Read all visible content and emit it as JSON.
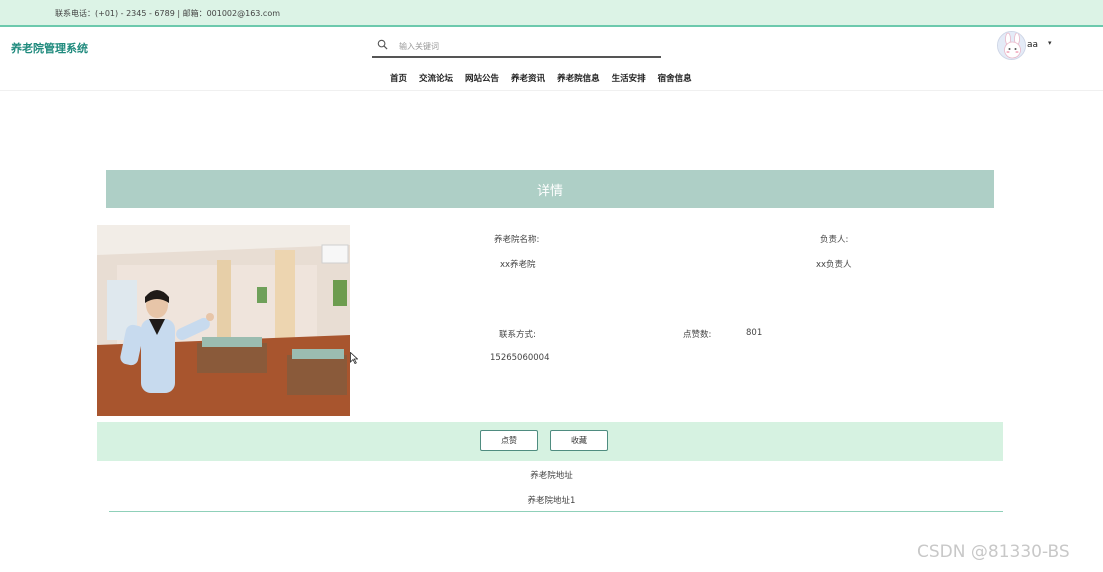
{
  "topbar": {
    "contact": "联系电话：(+01) - 2345 - 6789 | 邮箱：001002@163.com"
  },
  "header": {
    "brand": "养老院管理系统",
    "search_placeholder": "输入关键词",
    "user_name": "aa",
    "caret": "▾"
  },
  "nav": {
    "items": [
      "首页",
      "交流论坛",
      "网站公告",
      "养老资讯",
      "养老院信息",
      "生活安排",
      "宿舍信息"
    ]
  },
  "detail": {
    "title": "详情",
    "name_label": "养老院名称:",
    "name_value": "xx养老院",
    "manager_label": "负责人:",
    "manager_value": "xx负责人",
    "contact_label": "联系方式:",
    "contact_value": "15265060004",
    "likes_label": "点赞数:",
    "likes_value": "801"
  },
  "actions": {
    "like": "点赞",
    "favorite": "收藏"
  },
  "address": {
    "label": "养老院地址",
    "value": "养老院地址1"
  },
  "watermark": "CSDN @81330-BS",
  "colors": {
    "topbar_bg": "#dcf3e6",
    "brand": "#1f8a7d",
    "detail_header_bg": "#aecfc6",
    "action_bar_bg": "#d6f2e1"
  }
}
